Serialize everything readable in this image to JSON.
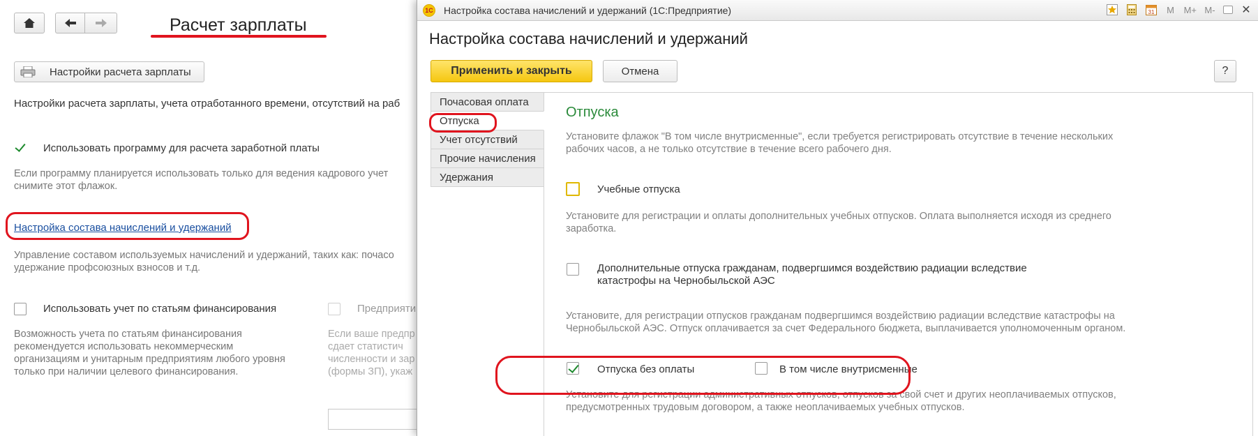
{
  "background": {
    "nav": {
      "home_icon": "home-icon",
      "back_icon": "arrow-left-icon",
      "forward_icon": "arrow-right-icon"
    },
    "title": "Расчет зарплаты",
    "settings_button": "Настройки расчета зарплаты",
    "intro": "Настройки расчета зарплаты, учета отработанного времени, отсутствий на раб",
    "use_program": {
      "label": "Использовать программу для расчета заработной платы",
      "checked": true,
      "hint_line1": "Если программу планируется использовать только для ведения кадрового учет",
      "hint_line2": "снимите этот флажок."
    },
    "link": "Настройка состава начислений и удержаний",
    "link_hint_line1": "Управление составом используемых начислений и удержаний, таких как: почасо",
    "link_hint_line2": "удержание профсоюзных взносов и т.д.",
    "financing": {
      "label": "Использовать учет по статьям финансирования",
      "hint": [
        "Возможность учета по статьям финансирования",
        "рекомендуется использовать некоммерческим",
        "организациям и унитарным предприятиям любого уровня",
        "только при наличии целевого финансирования."
      ]
    },
    "enterprise": {
      "label": "Предприяти",
      "hint": [
        "Если ваше предпр",
        "сдает статистич",
        "численности и зар",
        "(формы ЗП), укаж"
      ]
    }
  },
  "dialog": {
    "window_title": "Настройка состава начислений и удержаний (1С:Предприятие)",
    "logo_text": "1С",
    "toolbar_icons": [
      "star-icon",
      "calculator-icon",
      "calendar-icon"
    ],
    "memory_buttons": [
      "M",
      "M+",
      "M-"
    ],
    "heading": "Настройка состава начислений и удержаний",
    "apply_button": "Применить и закрыть",
    "cancel_button": "Отмена",
    "help_button": "?",
    "nav_items": [
      {
        "label": "Почасовая оплата",
        "active": false
      },
      {
        "label": "Отпуска",
        "active": true
      },
      {
        "label": "Учет отсутствий",
        "active": false
      },
      {
        "label": "Прочие начисления",
        "active": false
      },
      {
        "label": "Удержания",
        "active": false
      }
    ],
    "section": {
      "title": "Отпуска",
      "intro_line1": "Установите флажок \"В том числе внутрисменные\", если требуется регистрировать отсутствие в течение нескольких",
      "intro_line2": "рабочих часов, а не только отсутствие в течение всего рабочего дня.",
      "study_leave": {
        "label": "Учебные отпуска",
        "checked": false,
        "hint_line1": "Установите для регистрации и оплаты дополнительных учебных отпусков. Оплата выполняется исходя из среднего",
        "hint_line2": "заработка."
      },
      "chernobyl": {
        "label_line1": "Дополнительные отпуска гражданам, подвергшимся воздействию радиации вследствие",
        "label_line2": "катастрофы на Чернобыльской АЭС",
        "checked": false,
        "hint_line1": "Установите, для регистрации отпусков гражданам подвергшимся воздействию радиации вследствие катастрофы на",
        "hint_line2": "Чернобыльской АЭС. Отпуск оплачивается за счет Федерального бюджета, выплачивается уполномоченным органом."
      },
      "unpaid": {
        "label": "Отпуска без оплаты",
        "checked": true,
        "intrashift_label": "В том числе внутрисменные",
        "intrashift_checked": false,
        "hint_line1": "Установите для регистрации административных отпусков, отпусков за свой счет и других неоплачиваемых отпусков,",
        "hint_line2": "предусмотренных трудовым договором, а также неоплачиваемых учебных отпусков."
      }
    }
  },
  "colors": {
    "accent_red": "#e0141e",
    "section_green": "#2a8a3a",
    "apply_yellow": "#f5c710",
    "link_blue": "#1a4fa0"
  }
}
